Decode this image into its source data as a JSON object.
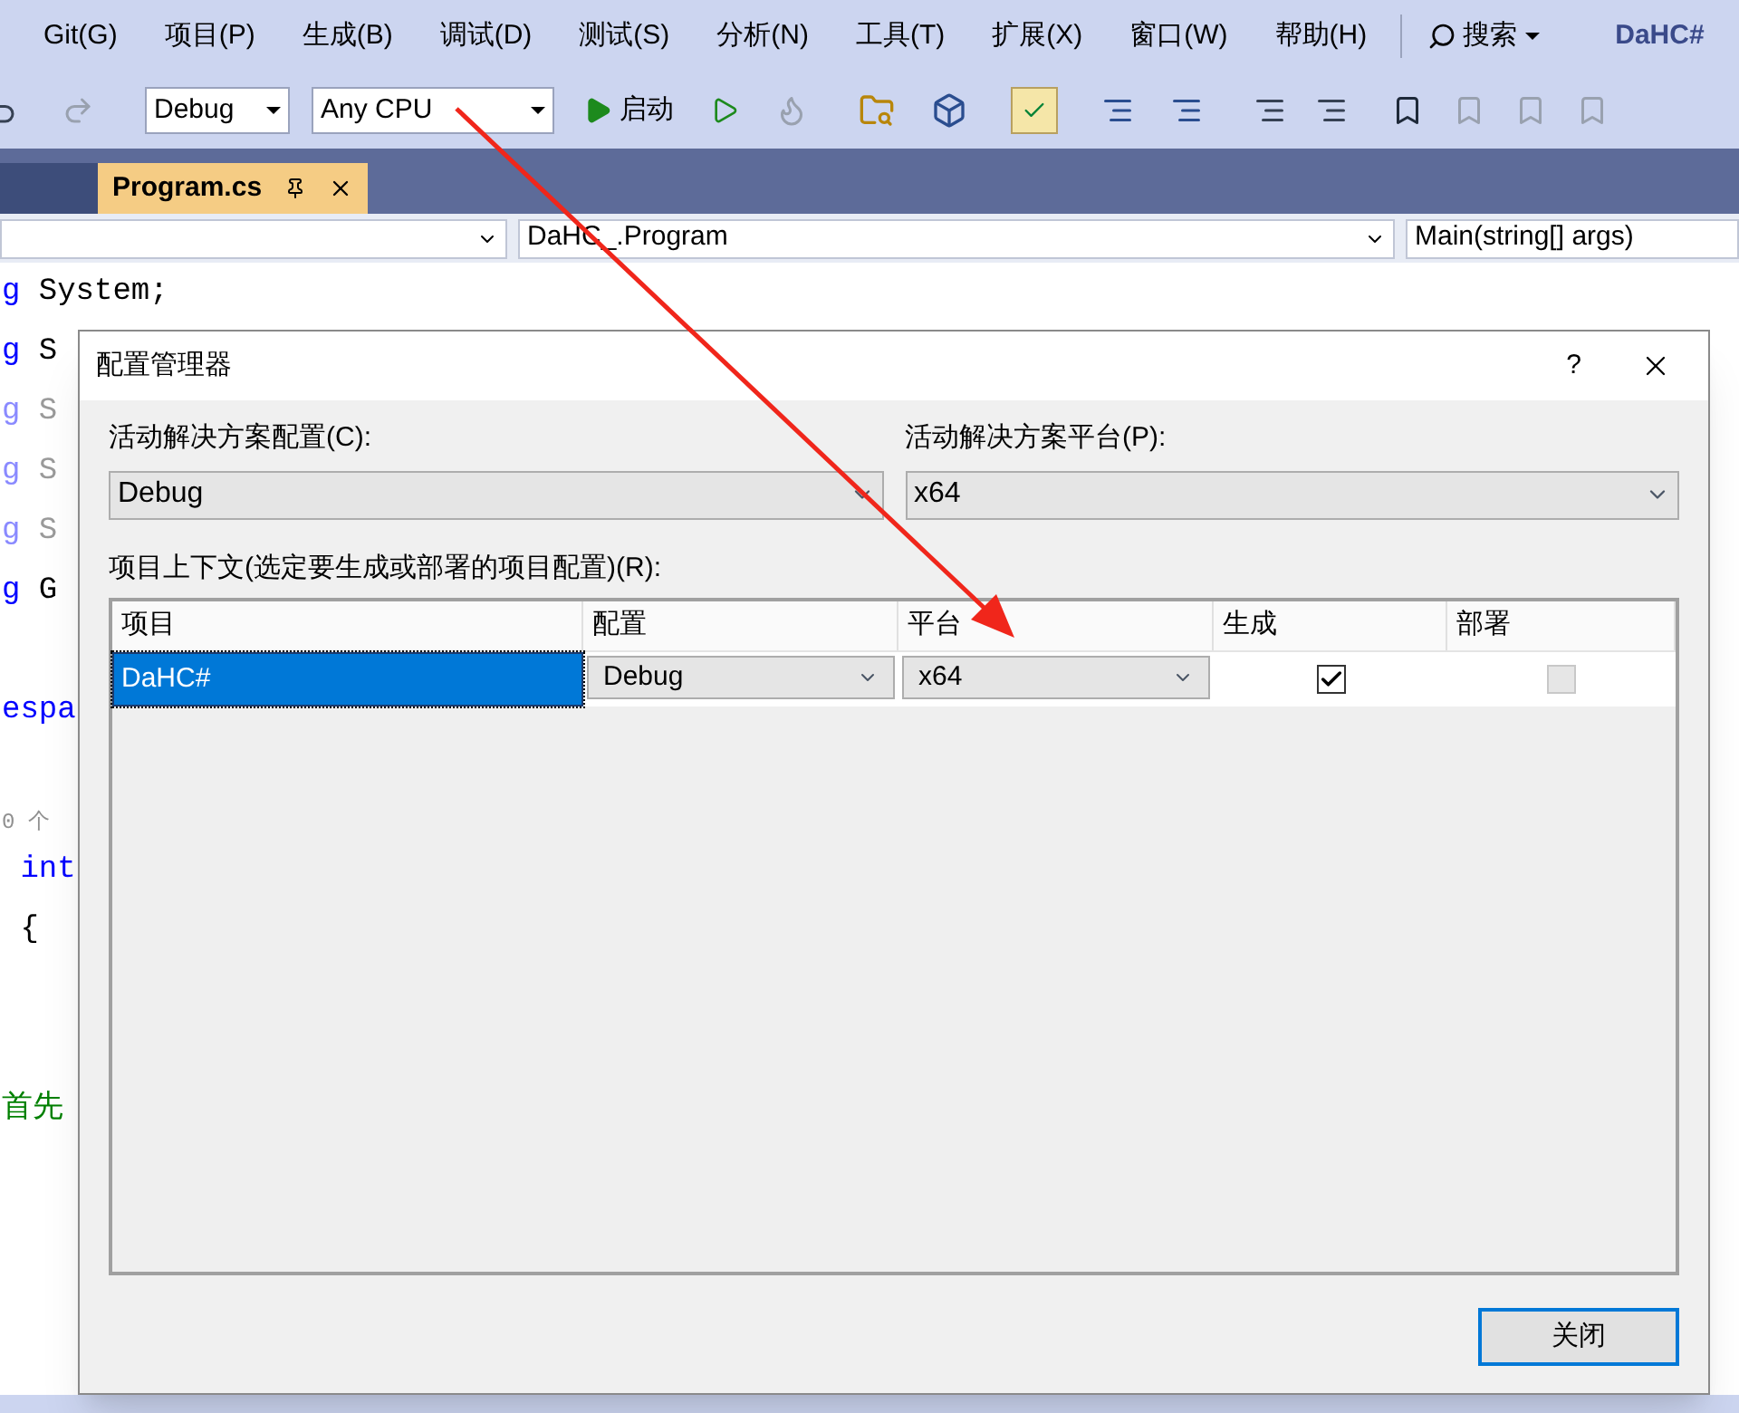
{
  "menu": [
    "Git(G)",
    "项目(P)",
    "生成(B)",
    "调试(D)",
    "测试(S)",
    "分析(N)",
    "工具(T)",
    "扩展(X)",
    "窗口(W)",
    "帮助(H)"
  ],
  "search": {
    "label": "搜索"
  },
  "solution_name": "DaHC#",
  "toolbar": {
    "configuration": "Debug",
    "platform": "Any CPU",
    "start": "启动"
  },
  "tabs": [
    {
      "label": "Program.cs",
      "selected": true
    }
  ],
  "navigation": {
    "type": "DaHC_.Program",
    "member": "Main(string[] args)"
  },
  "code_lines": [
    {
      "kind": "code",
      "tokens": [
        {
          "text": "g",
          "kind": "keyword"
        },
        {
          "text": " System;",
          "kind": "plain"
        }
      ]
    },
    {
      "kind": "code",
      "tokens": [
        {
          "text": "g",
          "kind": "keyword"
        },
        {
          "text": " S",
          "kind": "plain"
        }
      ]
    },
    {
      "kind": "code",
      "tokens": [
        {
          "text": "g",
          "kind": "faded"
        },
        {
          "text": " S",
          "kind": "fadedplain"
        }
      ]
    },
    {
      "kind": "code",
      "tokens": [
        {
          "text": "g",
          "kind": "faded"
        },
        {
          "text": " S",
          "kind": "fadedplain"
        }
      ]
    },
    {
      "kind": "code",
      "tokens": [
        {
          "text": "g",
          "kind": "faded"
        },
        {
          "text": " S",
          "kind": "fadedplain"
        }
      ]
    },
    {
      "kind": "code",
      "tokens": [
        {
          "text": "g",
          "kind": "keyword"
        },
        {
          "text": " G",
          "kind": "plain"
        }
      ]
    },
    {
      "kind": "blank"
    },
    {
      "kind": "code",
      "tokens": [
        {
          "text": "espa",
          "kind": "keyword"
        }
      ]
    },
    {
      "kind": "blank"
    },
    {
      "kind": "codelens",
      "tokens": [
        {
          "text": "0 个",
          "kind": "codelens"
        }
      ]
    },
    {
      "kind": "code",
      "tokens": [
        {
          "text": " int",
          "kind": "keyword"
        }
      ]
    },
    {
      "kind": "code",
      "tokens": [
        {
          "text": " {",
          "kind": "plain"
        }
      ]
    },
    {
      "kind": "blank"
    },
    {
      "kind": "blank"
    },
    {
      "kind": "code",
      "tokens": [
        {
          "text": "首先",
          "kind": "comment"
        }
      ]
    }
  ],
  "dialog": {
    "title": "配置管理器",
    "help": "?",
    "solution_config": {
      "label": "活动解决方案配置(C):",
      "value": "Debug"
    },
    "solution_platform": {
      "label": "活动解决方案平台(P):",
      "value": "x64"
    },
    "grid_label": "项目上下文(选定要生成或部署的项目配置)(R):",
    "columns": [
      "项目",
      "配置",
      "平台",
      "生成",
      "部署"
    ],
    "rows": [
      {
        "project": "DaHC#",
        "selected": true,
        "configuration": "Debug",
        "platform": "x64",
        "build": {
          "checked": true,
          "disabled": false
        },
        "deploy": {
          "checked": false,
          "disabled": true
        }
      }
    ],
    "close_button": "关闭"
  }
}
